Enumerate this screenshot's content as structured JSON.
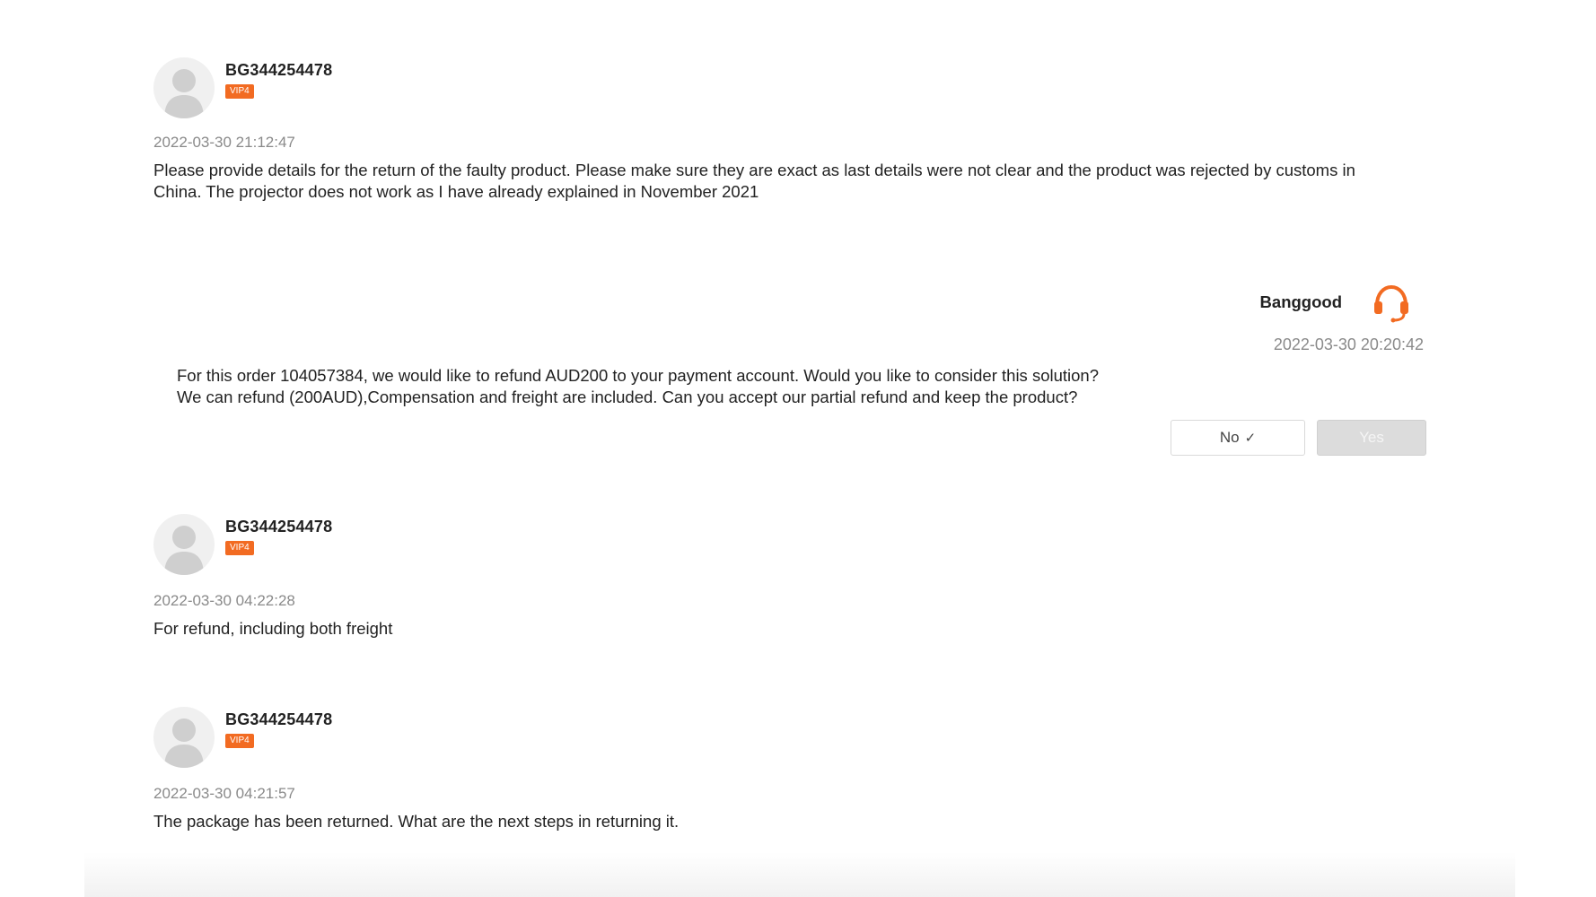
{
  "messages": [
    {
      "username": "BG344254478",
      "vip": "VIP4",
      "timestamp": "2022-03-30 21:12:47",
      "text_line1": "Please provide details for the return of the faulty product. Please make sure they are exact as last details were not clear and the product was rejected by customs in",
      "text_line2": "China. The projector does not work as I have already explained in November 2021"
    },
    {
      "username": "BG344254478",
      "vip": "VIP4",
      "timestamp": "2022-03-30 04:22:28",
      "text": "For refund, including both freight"
    },
    {
      "username": "BG344254478",
      "vip": "VIP4",
      "timestamp": "2022-03-30 04:21:57",
      "text": "The package has been returned. What are the next steps in returning it."
    }
  ],
  "support": {
    "name": "Banggood",
    "icon": "headset-icon",
    "timestamp": "2022-03-30 20:20:42",
    "text_line1": "For this order 104057384, we would like to refund AUD200 to your payment account. Would you like to consider this solution?",
    "text_line2": "We can refund (200AUD),Compensation and freight are included. Can you accept our partial refund and keep the product?",
    "buttons": {
      "no_label": "No",
      "no_selected_icon": "✓",
      "yes_label": "Yes"
    }
  },
  "colors": {
    "accent": "#f26b22",
    "timestamp": "#8a8a8a",
    "text": "#222222"
  }
}
